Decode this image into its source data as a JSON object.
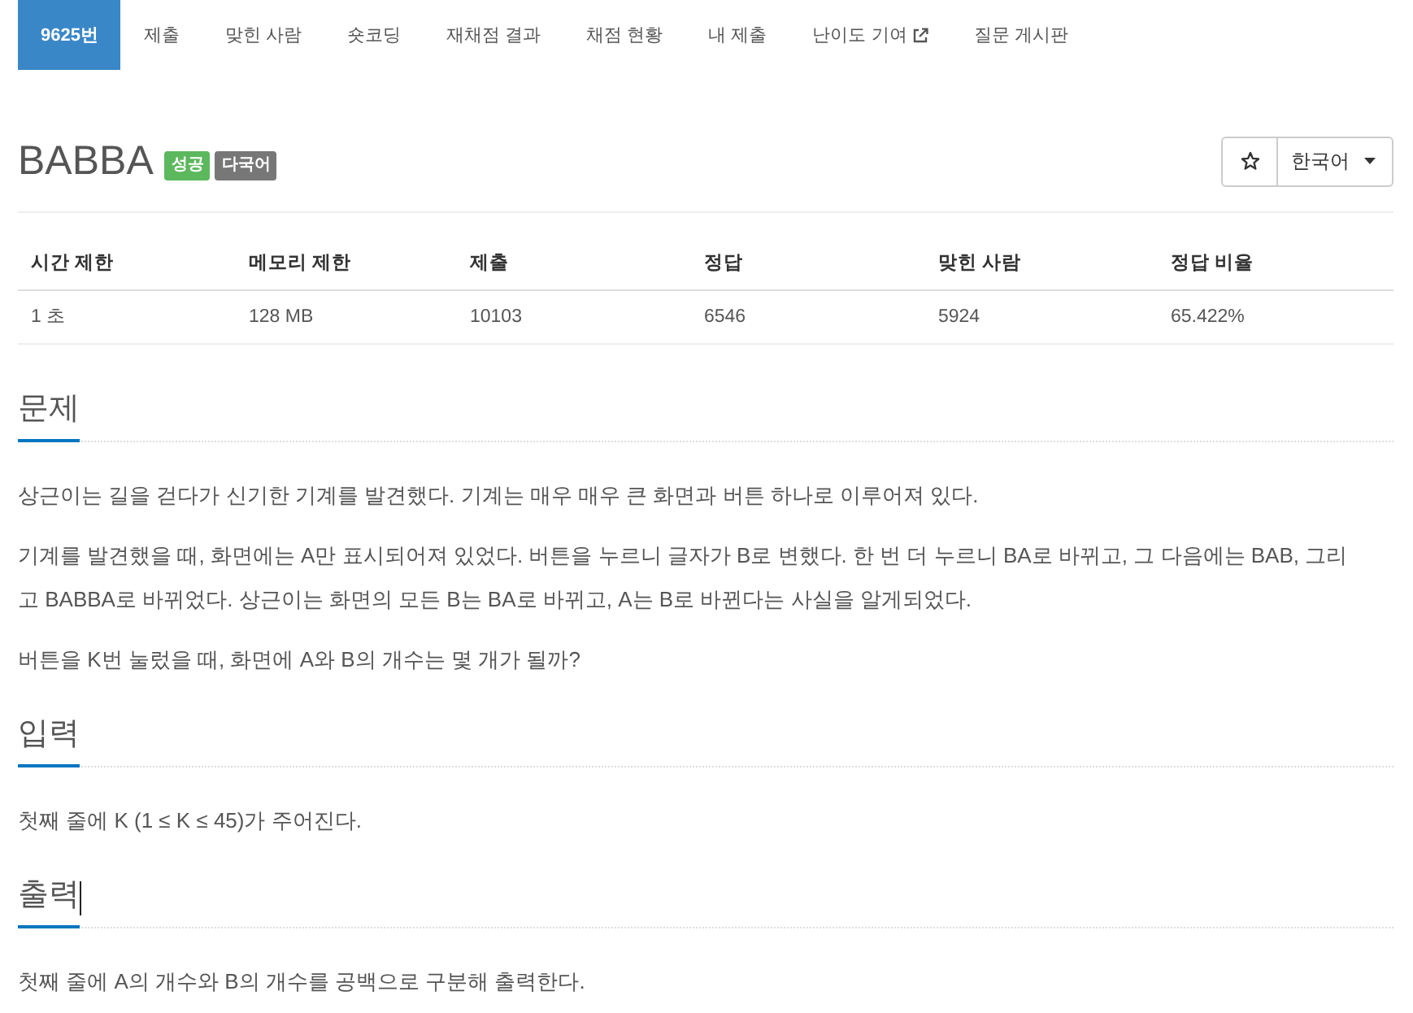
{
  "nav": {
    "tabs": [
      {
        "label": "9625번",
        "selected": true,
        "external": false
      },
      {
        "label": "제출",
        "selected": false,
        "external": false
      },
      {
        "label": "맞힌 사람",
        "selected": false,
        "external": false
      },
      {
        "label": "숏코딩",
        "selected": false,
        "external": false
      },
      {
        "label": "재채점 결과",
        "selected": false,
        "external": false
      },
      {
        "label": "채점 현황",
        "selected": false,
        "external": false
      },
      {
        "label": "내 제출",
        "selected": false,
        "external": false
      },
      {
        "label": "난이도 기여",
        "selected": false,
        "external": true
      },
      {
        "label": "질문 게시판",
        "selected": false,
        "external": false
      }
    ]
  },
  "problem": {
    "title": "BABBA",
    "labels": [
      {
        "text": "성공",
        "color": "#5cb85c"
      },
      {
        "text": "다국어",
        "color": "#777777"
      }
    ],
    "language": "한국어"
  },
  "limits": {
    "columns": [
      "시간 제한",
      "메모리 제한",
      "제출",
      "정답",
      "맞힌 사람",
      "정답 비율"
    ],
    "rows": [
      [
        "1 초",
        "128 MB",
        "10103",
        "6546",
        "5924",
        "65.422%"
      ]
    ]
  },
  "sections": [
    {
      "heading": "문제",
      "text_cursor": false,
      "paragraphs": [
        "상근이는 길을 걷다가 신기한 기계를 발견했다. 기계는 매우 매우 큰 화면과 버튼 하나로 이루어져 있다.",
        "기계를 발견했을 때, 화면에는 A만 표시되어져 있었다. 버튼을 누르니 글자가 B로 변했다. 한 번 더 누르니 BA로 바뀌고, 그 다음에는 BAB, 그리고 BABBA로 바뀌었다. 상근이는 화면의 모든 B는 BA로 바뀌고, A는 B로 바뀐다는 사실을 알게되었다.",
        "버튼을 K번 눌렀을 때, 화면에 A와 B의 개수는 몇 개가 될까?"
      ]
    },
    {
      "heading": "입력",
      "text_cursor": false,
      "paragraphs": [
        "첫째 줄에 K (1 ≤ K ≤ 45)가 주어진다."
      ]
    },
    {
      "heading": "출력",
      "text_cursor": true,
      "paragraphs": [
        "첫째 줄에 A의 개수와 B의 개수를 공백으로 구분해 출력한다."
      ]
    }
  ]
}
